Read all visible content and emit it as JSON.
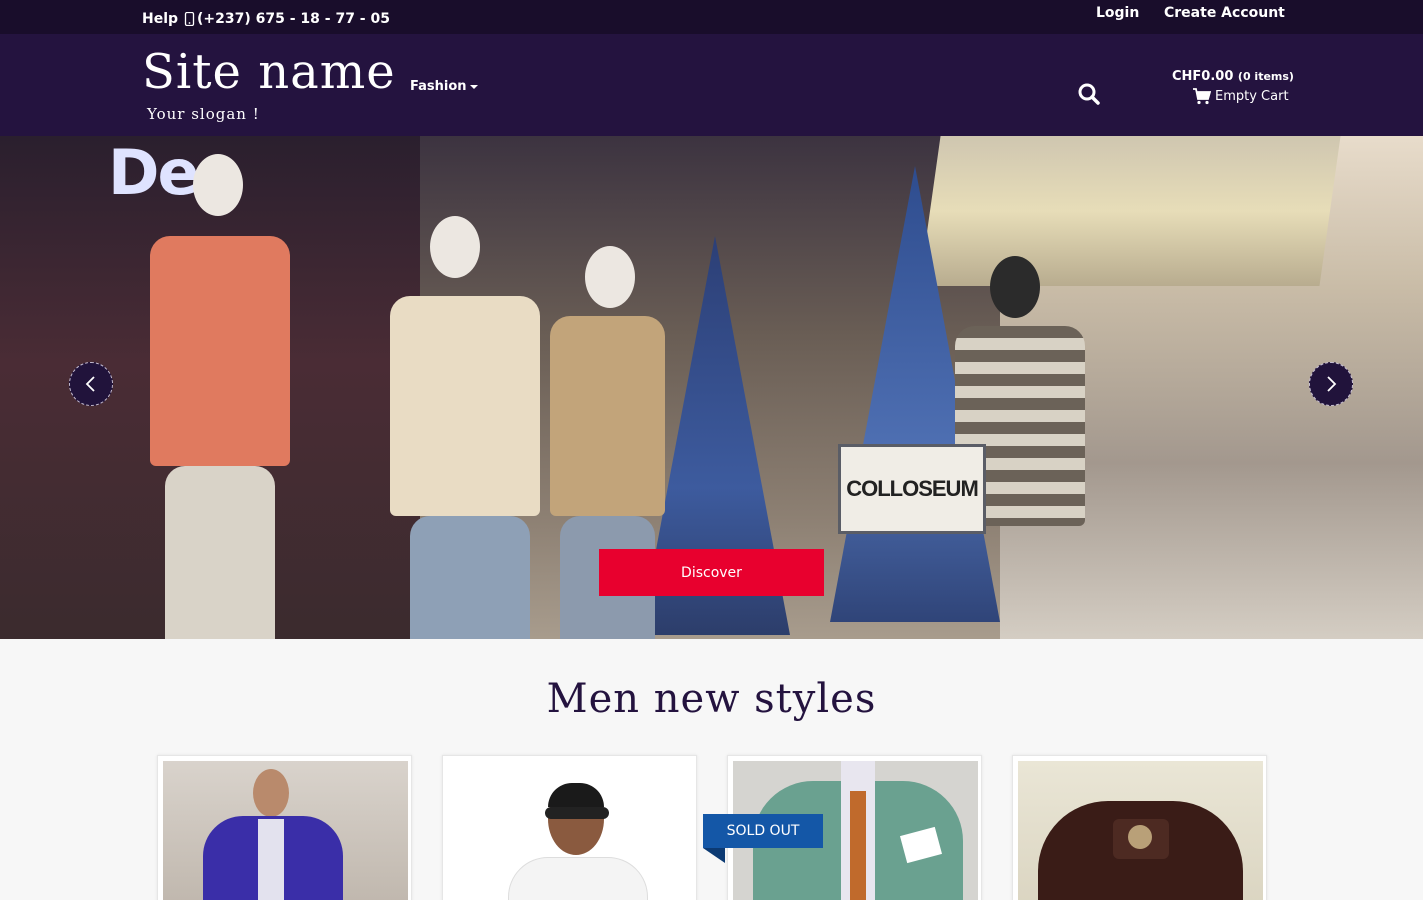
{
  "topbar": {
    "help": "Help",
    "phone": "(+237) 675 - 18 - 77 - 05",
    "login": "Login",
    "create_account": "Create Account"
  },
  "header": {
    "site_name": "Site name",
    "slogan": "Your slogan !",
    "nav": [
      {
        "label": "Fashion"
      }
    ],
    "cart": {
      "total": "CHF0.00",
      "items": "(0 items)",
      "status": "Empty Cart"
    },
    "icons": [
      "phone-icon",
      "search-icon",
      "cart-icon",
      "caret-down-icon"
    ]
  },
  "hero": {
    "store_sign": "Dea",
    "plaque": "COLLOSEUM",
    "cta": "Discover",
    "icons": [
      "chevron-left-icon",
      "chevron-right-icon"
    ]
  },
  "section": {
    "title": "Men new styles"
  },
  "products": [
    {
      "badge": ""
    },
    {
      "badge": ""
    },
    {
      "badge": "SOLD OUT"
    },
    {
      "badge": ""
    }
  ],
  "colors": {
    "topbar": "#190d2b",
    "header": "#24133f",
    "cta": "#e8002e",
    "badge": "#1457a7"
  }
}
